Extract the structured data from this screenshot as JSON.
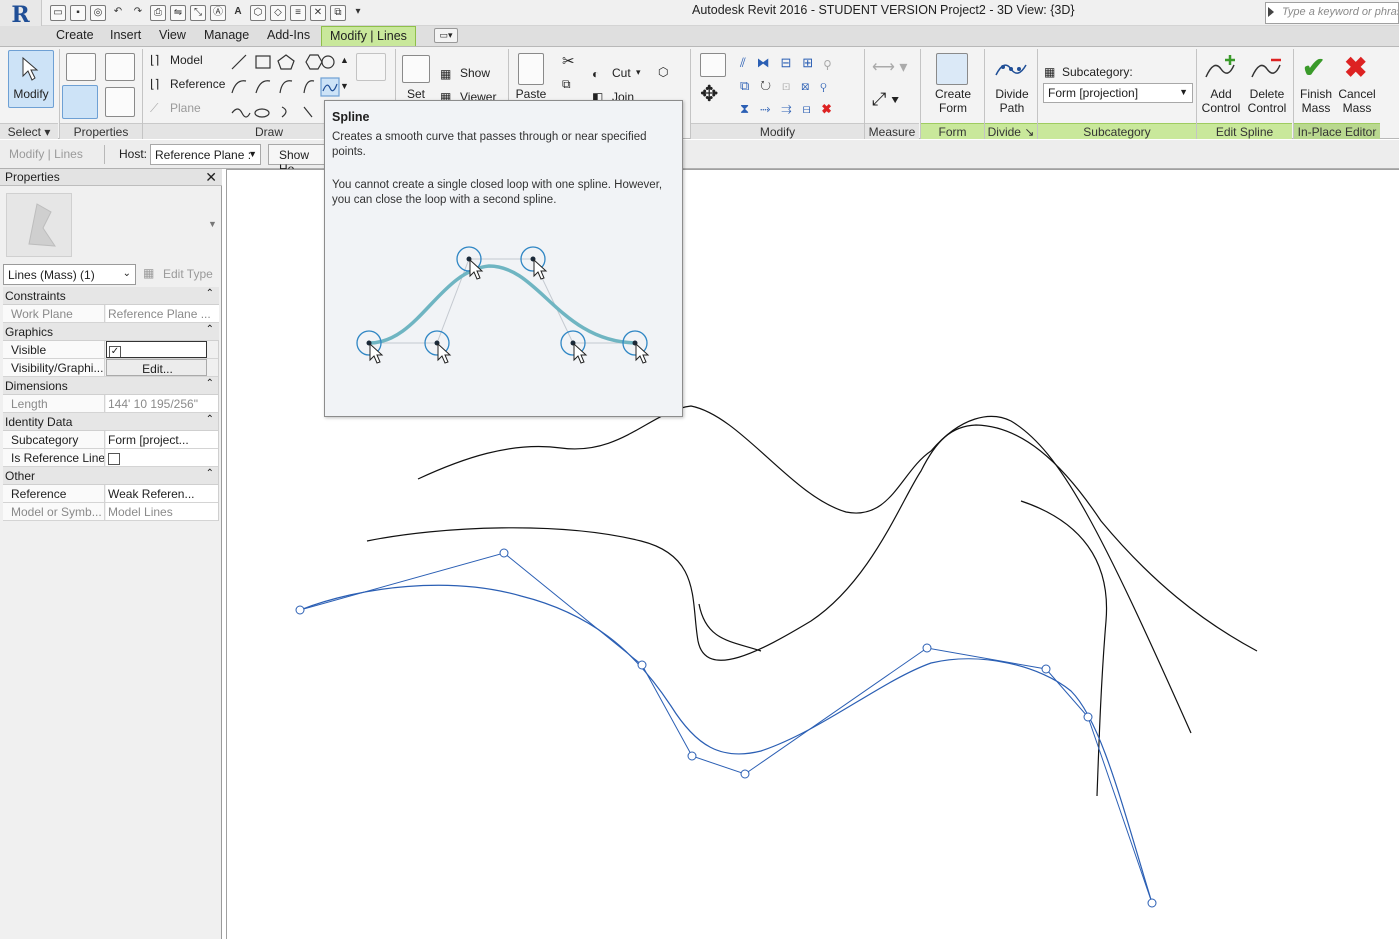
{
  "window": {
    "title": "Autodesk Revit 2016 - STUDENT VERSION -",
    "document": "Project2 - 3D View: {3D}",
    "search_placeholder": "Type a keyword or phrase"
  },
  "tabs": [
    "Create",
    "Insert",
    "View",
    "Manage",
    "Add-Ins",
    "Modify | Lines"
  ],
  "ribbon": {
    "modify_label": "Modify",
    "draw": {
      "model": "Model",
      "reference": "Reference",
      "plane": "Plane"
    },
    "workplane": {
      "set": "Set",
      "show": "Show",
      "viewer": "Viewer"
    },
    "clipboard": {
      "paste": "Paste",
      "cut": "Cut",
      "join": "Join"
    },
    "form": {
      "create_form": "Create Form"
    },
    "divide": {
      "divide_path": "Divide Path"
    },
    "subcategory": {
      "label": "Subcategory:",
      "value": "Form [projection]"
    },
    "edit_spline": {
      "add_control": "Add Control",
      "delete_control": "Delete Control"
    },
    "inplace": {
      "finish_mass": "Finish Mass",
      "cancel_mass": "Cancel Mass"
    },
    "panels": {
      "select": "Select",
      "properties": "Properties",
      "draw": "Draw",
      "modify": "Modify",
      "measure": "Measure",
      "form": "Form",
      "divide": "Divide",
      "subcategory": "Subcategory",
      "edit_spline": "Edit Spline",
      "inplace_editor": "In-Place Editor"
    }
  },
  "options_bar": {
    "context": "Modify | Lines",
    "host_label": "Host:",
    "host_value": "Reference Plane :",
    "show_host_btn": "Show Ho"
  },
  "properties": {
    "title": "Properties",
    "type_selector": "Lines (Mass) (1)",
    "edit_type": "Edit Type",
    "sections": [
      {
        "name": "Constraints",
        "rows": [
          {
            "k": "Work Plane",
            "v": "Reference Plane ...",
            "dim": true
          }
        ]
      },
      {
        "name": "Graphics",
        "rows": [
          {
            "k": "Visible",
            "v": "",
            "check": true
          },
          {
            "k": "Visibility/Graphi...",
            "v": "Edit...",
            "button": true
          }
        ]
      },
      {
        "name": "Dimensions",
        "rows": [
          {
            "k": "Length",
            "v": "144'  10 195/256\"",
            "dim": true
          }
        ]
      },
      {
        "name": "Identity Data",
        "rows": [
          {
            "k": "Subcategory",
            "v": "Form [project..."
          },
          {
            "k": "Is Reference Line",
            "v": "",
            "check": false
          }
        ]
      },
      {
        "name": "Other",
        "rows": [
          {
            "k": "Reference",
            "v": "Weak Referen..."
          },
          {
            "k": "Model or Symb...",
            "v": "Model Lines",
            "dim": true
          }
        ]
      }
    ]
  },
  "tooltip": {
    "title": "Spline",
    "p1": "Creates a smooth curve that passes through or near specified points.",
    "p2": "You cannot create a single closed loop with one spline. However, you can close the loop with a second spline."
  },
  "colors": {
    "accent_green": "#c9e89b",
    "spline_blue": "#2b5fb4",
    "tooltip_curve": "#6fb5c2"
  }
}
